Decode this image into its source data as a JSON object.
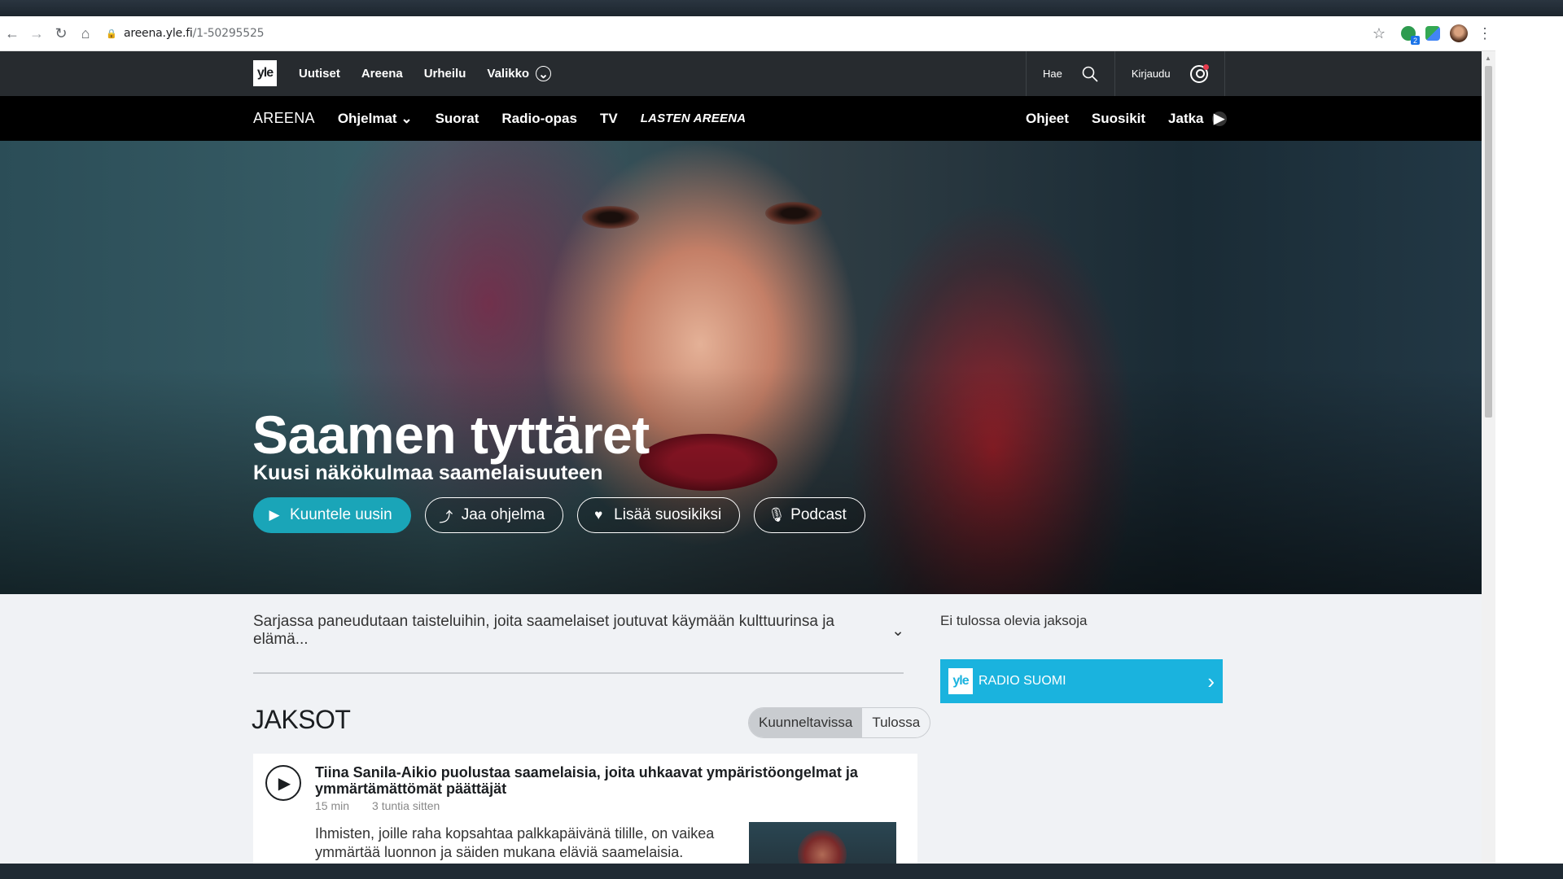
{
  "browser": {
    "url_host": "areena.yle.fi",
    "url_path": "/1-50295525"
  },
  "yle_nav": {
    "logo": "yle",
    "links": [
      "Uutiset",
      "Areena",
      "Urheilu",
      "Valikko"
    ],
    "search_label": "Hae",
    "login_label": "Kirjaudu"
  },
  "areena_nav": {
    "brand": "AREENA",
    "left_items": [
      "Ohjelmat",
      "Suorat",
      "Radio-opas",
      "TV",
      "LASTEN AREENA"
    ],
    "right_items": [
      "Ohjeet",
      "Suosikit",
      "Jatka"
    ]
  },
  "hero": {
    "title": "Saamen tyttäret",
    "subtitle": "Kuusi näkökulmaa saamelaisuuteen",
    "buttons": {
      "listen": "Kuuntele uusin",
      "share": "Jaa ohjelma",
      "favorite": "Lisää suosikiksi",
      "podcast": "Podcast"
    }
  },
  "description": "Sarjassa paneudutaan taisteluihin, joita saamelaiset joutuvat käymään kulttuurinsa ja elämä...",
  "aside": {
    "upcoming": "Ei tulossa olevia jaksoja",
    "channel_logo": "yle",
    "channel_name": "RADIO SUOMI"
  },
  "episodes_section": {
    "heading": "JAKSOT",
    "tabs": [
      "Kuunneltavissa",
      "Tulossa"
    ],
    "active_tab": "Kuunneltavissa"
  },
  "episodes": [
    {
      "title": "Tiina Sanila-Aikio puolustaa saamelaisia, joita uhkaavat ympäristöongelmat ja ymmärtämättömät päättäjät",
      "duration": "15 min",
      "published": "3 tuntia sitten",
      "description": "Ihmisten, joille raha kopsahtaa palkkapäivänä tilille, on vaikea ymmärtää luonnon ja säiden mukana eläviä saamelaisia."
    }
  ],
  "colors": {
    "yle_nav_bg": "#272b2f",
    "areena_nav_bg": "#000000",
    "accent": "#1aa5b8",
    "radio_banner": "#1ab3de",
    "page_bg": "#f0f2f5"
  }
}
